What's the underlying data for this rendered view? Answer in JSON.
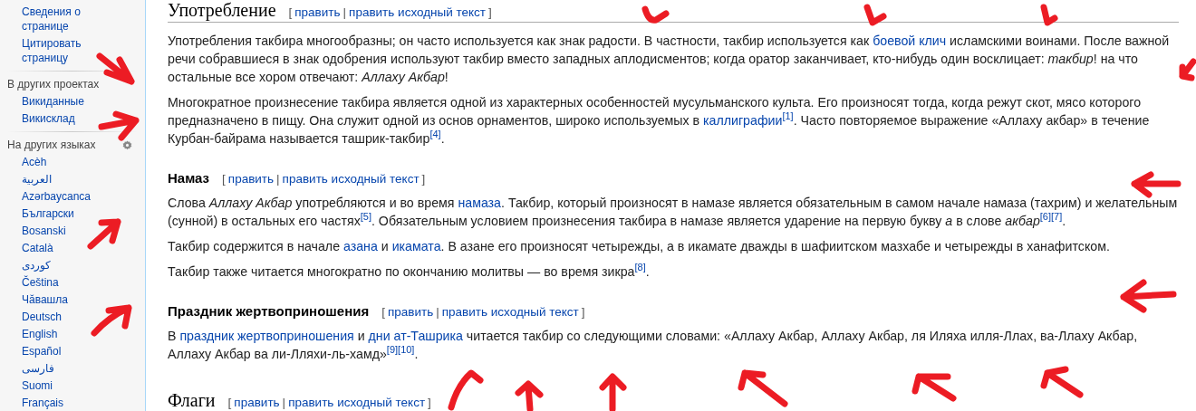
{
  "sidebar": {
    "tools": [
      "Сведения о странице",
      "Цитировать страницу"
    ],
    "projects": {
      "heading": "В других проектах",
      "items": [
        "Викиданные",
        "Викисклад"
      ]
    },
    "languages": {
      "heading": "На других языках",
      "items": [
        "Acèh",
        "العربية",
        "Azərbaycanca",
        "Български",
        "Bosanski",
        "Català",
        "کوردی",
        "Čeština",
        "Чӑвашла",
        "Deutsch",
        "English",
        "Español",
        "فارسی",
        "Suomi",
        "Français"
      ]
    }
  },
  "sections": [
    {
      "heading": "Употребление",
      "kind": "h2",
      "edit": [
        {
          "kind": "punct",
          "text": "["
        },
        {
          "kind": "link",
          "text": "править"
        },
        {
          "kind": "punct",
          "text": "|"
        },
        {
          "kind": "link",
          "text": "править исходный текст"
        },
        {
          "kind": "punct",
          "text": "]"
        }
      ],
      "paragraphs": [
        [
          {
            "kind": "text",
            "text": "Употребления такбира многообразны; он часто используется как знак радости. В частности, такбир используется как "
          },
          {
            "kind": "link",
            "text": "боевой клич"
          },
          {
            "kind": "text",
            "text": " исламскими воинами. После важной речи собравшиеся в знак одобрения используют такбир вместо западных аплодисментов; когда оратор заканчивает, кто-нибудь один восклицает: *такбир*! на что остальные все хором отвечают: *Аллаху Акбар*!"
          }
        ],
        [
          {
            "kind": "text",
            "text": "Многократное произнесение такбира является одной из характерных особенностей мусульманского культа. Его произносят тогда, когда режут скот, мясо которого предназначено в пищу. Она служит одной из основ орнаментов, широко используемых в "
          },
          {
            "kind": "link",
            "text": "каллиграфии"
          },
          {
            "kind": "ref",
            "text": "[1]"
          },
          {
            "kind": "text",
            "text": ". Часто повторяемое выражение «Аллаху акбар» в течение Курбан-байрама называется ташрик-такбир"
          },
          {
            "kind": "ref",
            "text": "[4]"
          },
          {
            "kind": "text",
            "text": "."
          }
        ]
      ]
    },
    {
      "heading": "Намаз",
      "kind": "h3",
      "edit": [
        {
          "kind": "punct",
          "text": "["
        },
        {
          "kind": "link",
          "text": "править"
        },
        {
          "kind": "punct",
          "text": "|"
        },
        {
          "kind": "link",
          "text": "править исходный текст"
        },
        {
          "kind": "punct",
          "text": "]"
        }
      ],
      "paragraphs": [
        [
          {
            "kind": "text",
            "text": "Слова *Аллаху Акбар* употребляются и во время "
          },
          {
            "kind": "link",
            "text": "намаза"
          },
          {
            "kind": "text",
            "text": ". Такбир, который произносят в намазе является обязательным в самом начале намаза (тахрим) и желательным (сунной) в остальных его частях"
          },
          {
            "kind": "ref",
            "text": "[5]"
          },
          {
            "kind": "text",
            "text": ". Обязательным условием произнесения такбира в намазе является ударение на первую букву *а* в слове *акбар*"
          },
          {
            "kind": "ref",
            "text": "[6]"
          },
          {
            "kind": "ref",
            "text": "[7]"
          },
          {
            "kind": "text",
            "text": "."
          }
        ],
        [
          {
            "kind": "text",
            "text": "Такбир содержится в начале "
          },
          {
            "kind": "link",
            "text": "азана"
          },
          {
            "kind": "text",
            "text": " и "
          },
          {
            "kind": "link",
            "text": "икамата"
          },
          {
            "kind": "text",
            "text": ". В азане его произносят четырежды, а в икамате дважды в шафиитском мазхабе и четырежды в ханафитском."
          }
        ],
        [
          {
            "kind": "text",
            "text": "Такбир также читается многократно по окончанию молитвы — во время зикра"
          },
          {
            "kind": "ref",
            "text": "[8]"
          },
          {
            "kind": "text",
            "text": "."
          }
        ]
      ]
    },
    {
      "heading": "Праздник жертвоприношения",
      "kind": "h3",
      "edit": [
        {
          "kind": "punct",
          "text": "["
        },
        {
          "kind": "link",
          "text": "править"
        },
        {
          "kind": "punct",
          "text": "|"
        },
        {
          "kind": "link",
          "text": "править исходный текст"
        },
        {
          "kind": "punct",
          "text": "]"
        }
      ],
      "paragraphs": [
        [
          {
            "kind": "text",
            "text": "В "
          },
          {
            "kind": "link",
            "text": "праздник жертвоприношения"
          },
          {
            "kind": "text",
            "text": " и "
          },
          {
            "kind": "link",
            "text": "дни ат-Ташрика"
          },
          {
            "kind": "text",
            "text": " читается такбир со следующими словами: «Аллаху Акбар, Аллаху Акбар, ля Иляха илля-Ллах, ва-Ллаху Акбар, Аллаху Акбар ва ли-Лляхи-ль-хамд»"
          },
          {
            "kind": "ref",
            "text": "[9]"
          },
          {
            "kind": "ref",
            "text": "[10]"
          },
          {
            "kind": "text",
            "text": "."
          }
        ]
      ]
    },
    {
      "heading": "Флаги",
      "kind": "h2",
      "edit": [
        {
          "kind": "punct",
          "text": "["
        },
        {
          "kind": "link",
          "text": "править"
        },
        {
          "kind": "punct",
          "text": "|"
        },
        {
          "kind": "link",
          "text": "править исходный текст"
        },
        {
          "kind": "punct",
          "text": "]"
        }
      ]
    }
  ]
}
